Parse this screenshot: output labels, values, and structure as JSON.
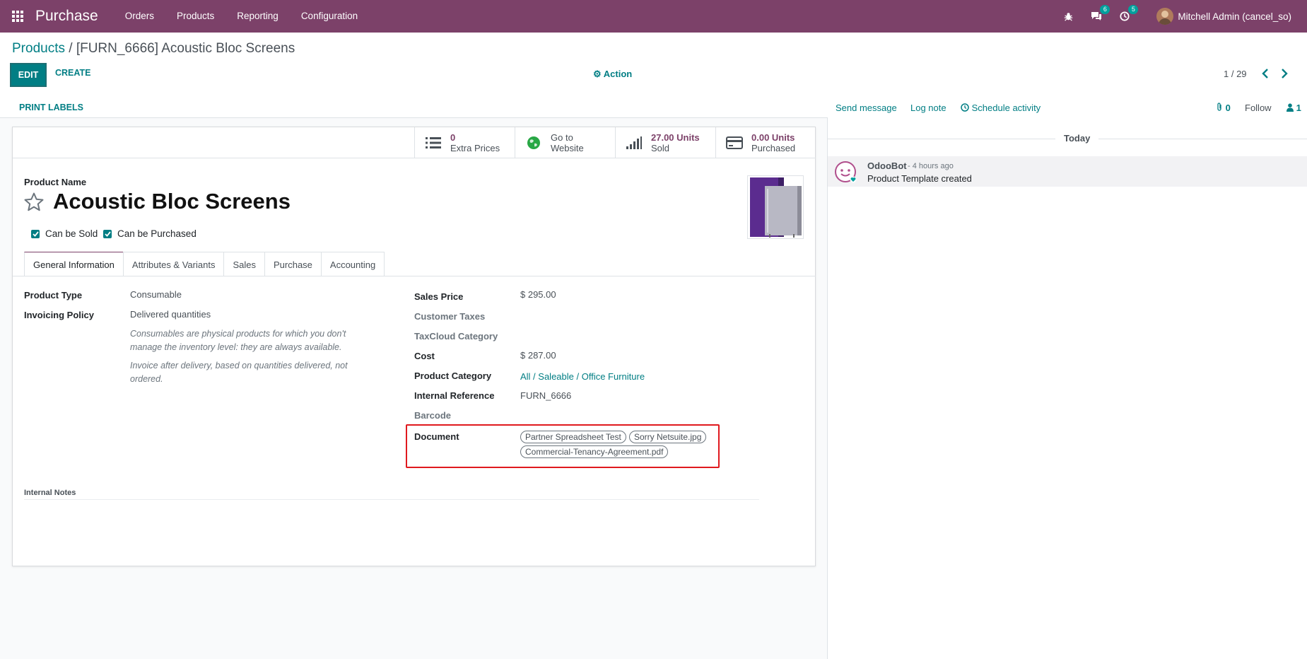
{
  "navbar": {
    "brand": "Purchase",
    "menu": [
      "Orders",
      "Products",
      "Reporting",
      "Configuration"
    ],
    "messages_count": "6",
    "activities_count": "5",
    "user_name": "Mitchell Admin (cancel_so)"
  },
  "control_panel": {
    "breadcrumb_root": "Products",
    "breadcrumb_current": " / [FURN_6666] Acoustic Bloc Screens",
    "edit_label": "EDIT",
    "create_label": "CREATE",
    "action_label": "Action",
    "pager": "1 / 29"
  },
  "statusbar": {
    "print_labels": "PRINT LABELS"
  },
  "smart_buttons": [
    {
      "value": "0",
      "label": "Extra Prices",
      "icon": "list-icon"
    },
    {
      "value": "Go to",
      "label": "Website",
      "icon": "globe-icon"
    },
    {
      "value": "27.00 Units",
      "label": "Sold",
      "icon": "signal-icon"
    },
    {
      "value": "0.00 Units",
      "label": "Purchased",
      "icon": "credit-card-icon"
    }
  ],
  "product": {
    "name_label": "Product Name",
    "name": "Acoustic Bloc Screens",
    "can_be_sold": "Can be Sold",
    "can_be_purchased": "Can be Purchased"
  },
  "tabs": [
    "General Information",
    "Attributes & Variants",
    "Sales",
    "Purchase",
    "Accounting"
  ],
  "left_fields": {
    "product_type_label": "Product Type",
    "product_type": "Consumable",
    "invoicing_policy_label": "Invoicing Policy",
    "invoicing_policy": "Delivered quantities",
    "help_consumable": "Consumables are physical products for which you don't manage the inventory level: they are always available.",
    "help_invoice": "Invoice after delivery, based on quantities delivered, not ordered."
  },
  "right_fields": {
    "sales_price_label": "Sales Price",
    "sales_price": "$ 295.00",
    "customer_taxes_label": "Customer Taxes",
    "taxcloud_label": "TaxCloud Category",
    "cost_label": "Cost",
    "cost": "$ 287.00",
    "category_label": "Product Category",
    "category": "All / Saleable / Office Furniture",
    "internal_ref_label": "Internal Reference",
    "internal_ref": "FURN_6666",
    "barcode_label": "Barcode",
    "document_label": "Document",
    "documents": [
      "Partner Spreadsheet Test",
      "Sorry Netsuite.jpg",
      "Commercial-Tenancy-Agreement.pdf"
    ]
  },
  "notes": {
    "label": "Internal Notes"
  },
  "chatter": {
    "send_message": "Send message",
    "log_note": "Log note",
    "schedule_activity": "Schedule activity",
    "attachments_count": "0",
    "follow": "Follow",
    "followers_count": "1",
    "today": "Today",
    "message": {
      "author": "OdooBot",
      "date": "- 4 hours ago",
      "body": "Product Template created"
    }
  },
  "colors": {
    "brand": "#7c4169",
    "accent": "#017e84",
    "highlight": "#e0191e"
  }
}
